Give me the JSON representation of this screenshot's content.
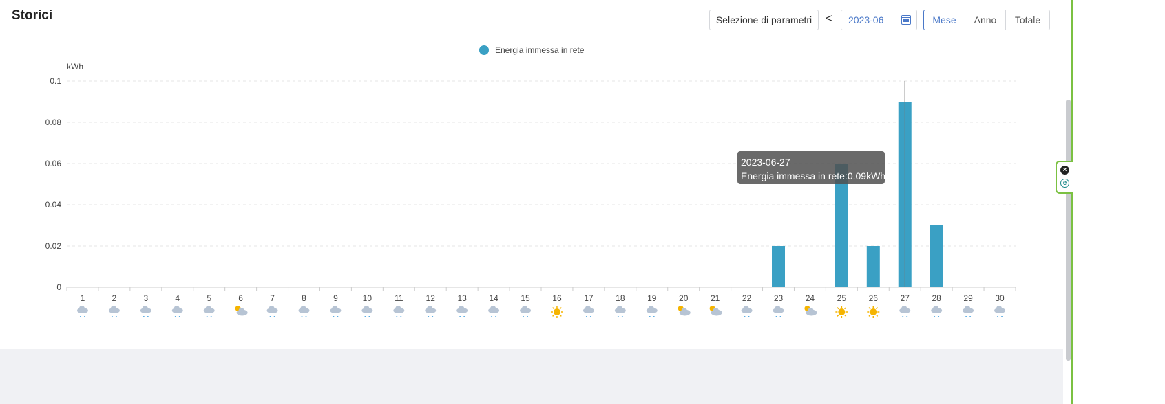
{
  "page": {
    "title": "Storici"
  },
  "toolbar": {
    "params_label": "Selezione di parametri",
    "prev_symbol": "<",
    "date_value": "2023-06",
    "tabs": [
      "Mese",
      "Anno",
      "Totale"
    ],
    "active_tab": "Mese"
  },
  "colors": {
    "bar": "#3aa0c4",
    "accent": "#4a78c8",
    "side_border": "#7bc142"
  },
  "chart_data": {
    "type": "bar",
    "unit_label": "kWh",
    "legend": [
      "Energia immessa in rete"
    ],
    "legend_position": "top-center",
    "grid": true,
    "ylim": [
      0,
      0.1
    ],
    "yticks": [
      "0",
      "0.02",
      "0.04",
      "0.06",
      "0.08",
      "0.1"
    ],
    "ytick_values": [
      0,
      0.02,
      0.04,
      0.06,
      0.08,
      0.1
    ],
    "categories": [
      "1",
      "2",
      "3",
      "4",
      "5",
      "6",
      "7",
      "8",
      "9",
      "10",
      "11",
      "12",
      "13",
      "14",
      "15",
      "16",
      "17",
      "18",
      "19",
      "20",
      "21",
      "22",
      "23",
      "24",
      "25",
      "26",
      "27",
      "28",
      "29",
      "30"
    ],
    "series": [
      {
        "name": "Energia immessa in rete",
        "values": [
          0,
          0,
          0,
          0,
          0,
          0,
          0,
          0,
          0,
          0,
          0,
          0,
          0,
          0,
          0,
          0,
          0,
          0,
          0,
          0,
          0,
          0,
          0.02,
          0,
          0.06,
          0.02,
          0.09,
          0.03,
          0,
          0
        ]
      }
    ],
    "weather_icons": [
      "snow-icon",
      "snow-icon",
      "snow-icon",
      "snow-icon",
      "snow-icon",
      "partly-cloudy-icon",
      "snow-icon",
      "snow-icon",
      "snow-icon",
      "snow-icon",
      "snow-icon",
      "snow-icon",
      "snow-icon",
      "snow-icon",
      "snow-icon",
      "sunny-icon",
      "snow-icon",
      "snow-icon",
      "snow-icon",
      "partly-cloudy-icon",
      "partly-cloudy-icon",
      "snow-icon",
      "snow-icon",
      "partly-cloudy-icon",
      "sunny-icon",
      "sunny-icon",
      "snow-icon",
      "snow-icon",
      "snow-icon",
      "snow-icon"
    ],
    "highlight_index": 26,
    "tooltip": {
      "date": "2023-06-27",
      "text": "Energia immessa in rete:0.09kWh"
    }
  }
}
